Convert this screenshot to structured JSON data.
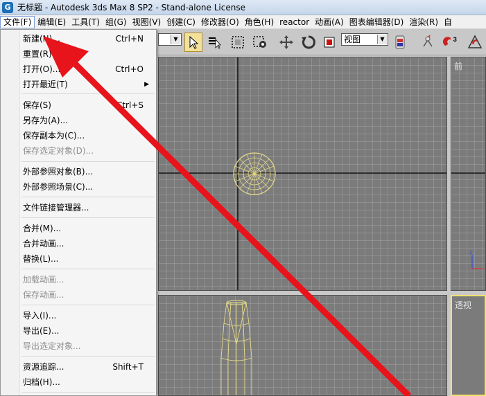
{
  "window": {
    "title": "无标题 - Autodesk 3ds Max 8 SP2  - Stand-alone License",
    "icon_glyph": "G"
  },
  "menubar": {
    "items": [
      {
        "label": "文件(F)"
      },
      {
        "label": "编辑(E)"
      },
      {
        "label": "工具(T)"
      },
      {
        "label": "组(G)"
      },
      {
        "label": "视图(V)"
      },
      {
        "label": "创建(C)"
      },
      {
        "label": "修改器(O)"
      },
      {
        "label": "角色(H)"
      },
      {
        "label": "reactor"
      },
      {
        "label": "动画(A)"
      },
      {
        "label": "图表编辑器(D)"
      },
      {
        "label": "渲染(R)"
      },
      {
        "label": "自"
      }
    ]
  },
  "toolbar": {
    "view_dropdown": "视图",
    "badge_3": "3"
  },
  "file_menu": {
    "items": [
      {
        "label": "新建(N)...",
        "shortcut": "Ctrl+N",
        "disabled": false
      },
      {
        "label": "重置(R)",
        "shortcut": "",
        "disabled": false
      },
      {
        "label": "打开(O)...",
        "shortcut": "Ctrl+O",
        "disabled": false
      },
      {
        "label": "打开最近(T)",
        "shortcut": "",
        "disabled": false
      },
      {
        "label": "保存(S)",
        "shortcut": "Ctrl+S",
        "disabled": false
      },
      {
        "label": "另存为(A)...",
        "shortcut": "",
        "disabled": false
      },
      {
        "label": "保存副本为(C)...",
        "shortcut": "",
        "disabled": false
      },
      {
        "label": "保存选定对象(D)...",
        "shortcut": "",
        "disabled": true
      },
      {
        "label": "外部参照对象(B)...",
        "shortcut": "",
        "disabled": false
      },
      {
        "label": "外部参照场景(C)...",
        "shortcut": "",
        "disabled": false
      },
      {
        "label": "文件链接管理器...",
        "shortcut": "",
        "disabled": false
      },
      {
        "label": "合并(M)...",
        "shortcut": "",
        "disabled": false
      },
      {
        "label": "合并动画...",
        "shortcut": "",
        "disabled": false
      },
      {
        "label": "替换(L)...",
        "shortcut": "",
        "disabled": false
      },
      {
        "label": "加载动画...",
        "shortcut": "",
        "disabled": true
      },
      {
        "label": "保存动画...",
        "shortcut": "",
        "disabled": true
      },
      {
        "label": "导入(I)...",
        "shortcut": "",
        "disabled": false
      },
      {
        "label": "导出(E)...",
        "shortcut": "",
        "disabled": false
      },
      {
        "label": "导出选定对象...",
        "shortcut": "",
        "disabled": true
      },
      {
        "label": "资源追踪...",
        "shortcut": "Shift+T",
        "disabled": false
      },
      {
        "label": "归档(H)...",
        "shortcut": "",
        "disabled": false
      }
    ]
  },
  "viewports": {
    "front_label": "前",
    "persp_label": "透视",
    "axis_z": "z"
  },
  "colors": {
    "annotation_arrow": "#e8141b",
    "wireframe": "#e9dc8a",
    "active_viewport_border": "#f2e36a"
  }
}
